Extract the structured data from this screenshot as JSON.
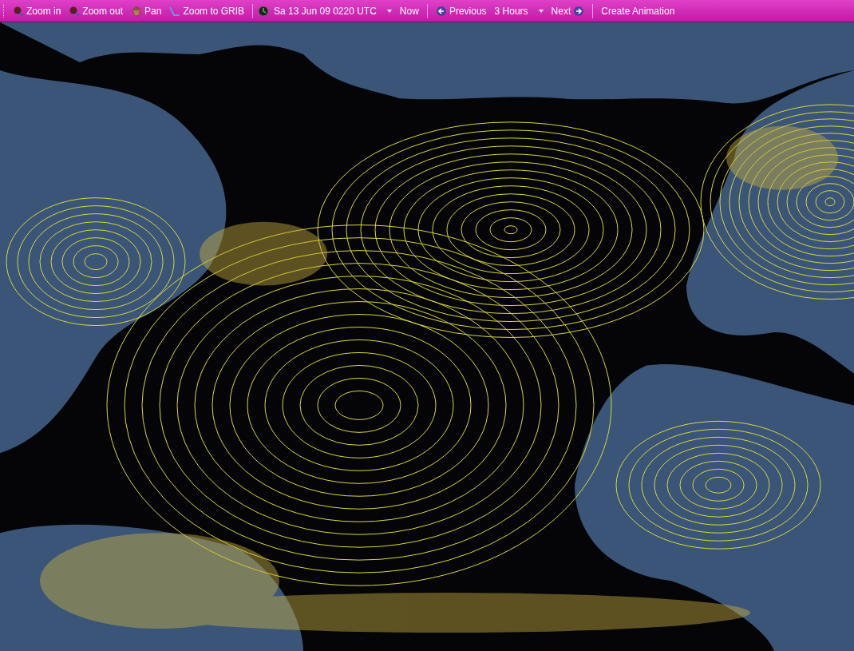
{
  "toolbar": {
    "groups": [
      [
        {
          "kind": "zoomin",
          "label": "Zoom in"
        },
        {
          "kind": "zoomout",
          "label": "Zoom out"
        },
        {
          "kind": "pan",
          "label": "Pan"
        },
        {
          "kind": "grib",
          "label": "Zoom to GRIB"
        }
      ],
      [
        {
          "kind": "date",
          "label": "Sa 13 Jun 09 0220 UTC"
        },
        {
          "kind": "now",
          "label": "Now"
        }
      ],
      [
        {
          "kind": "previous",
          "label": "Previous"
        },
        {
          "kind": "step",
          "label": "3 Hours"
        },
        {
          "kind": "next",
          "label": "Next"
        }
      ],
      [
        {
          "kind": "animate",
          "label": "Create Animation"
        }
      ]
    ]
  }
}
